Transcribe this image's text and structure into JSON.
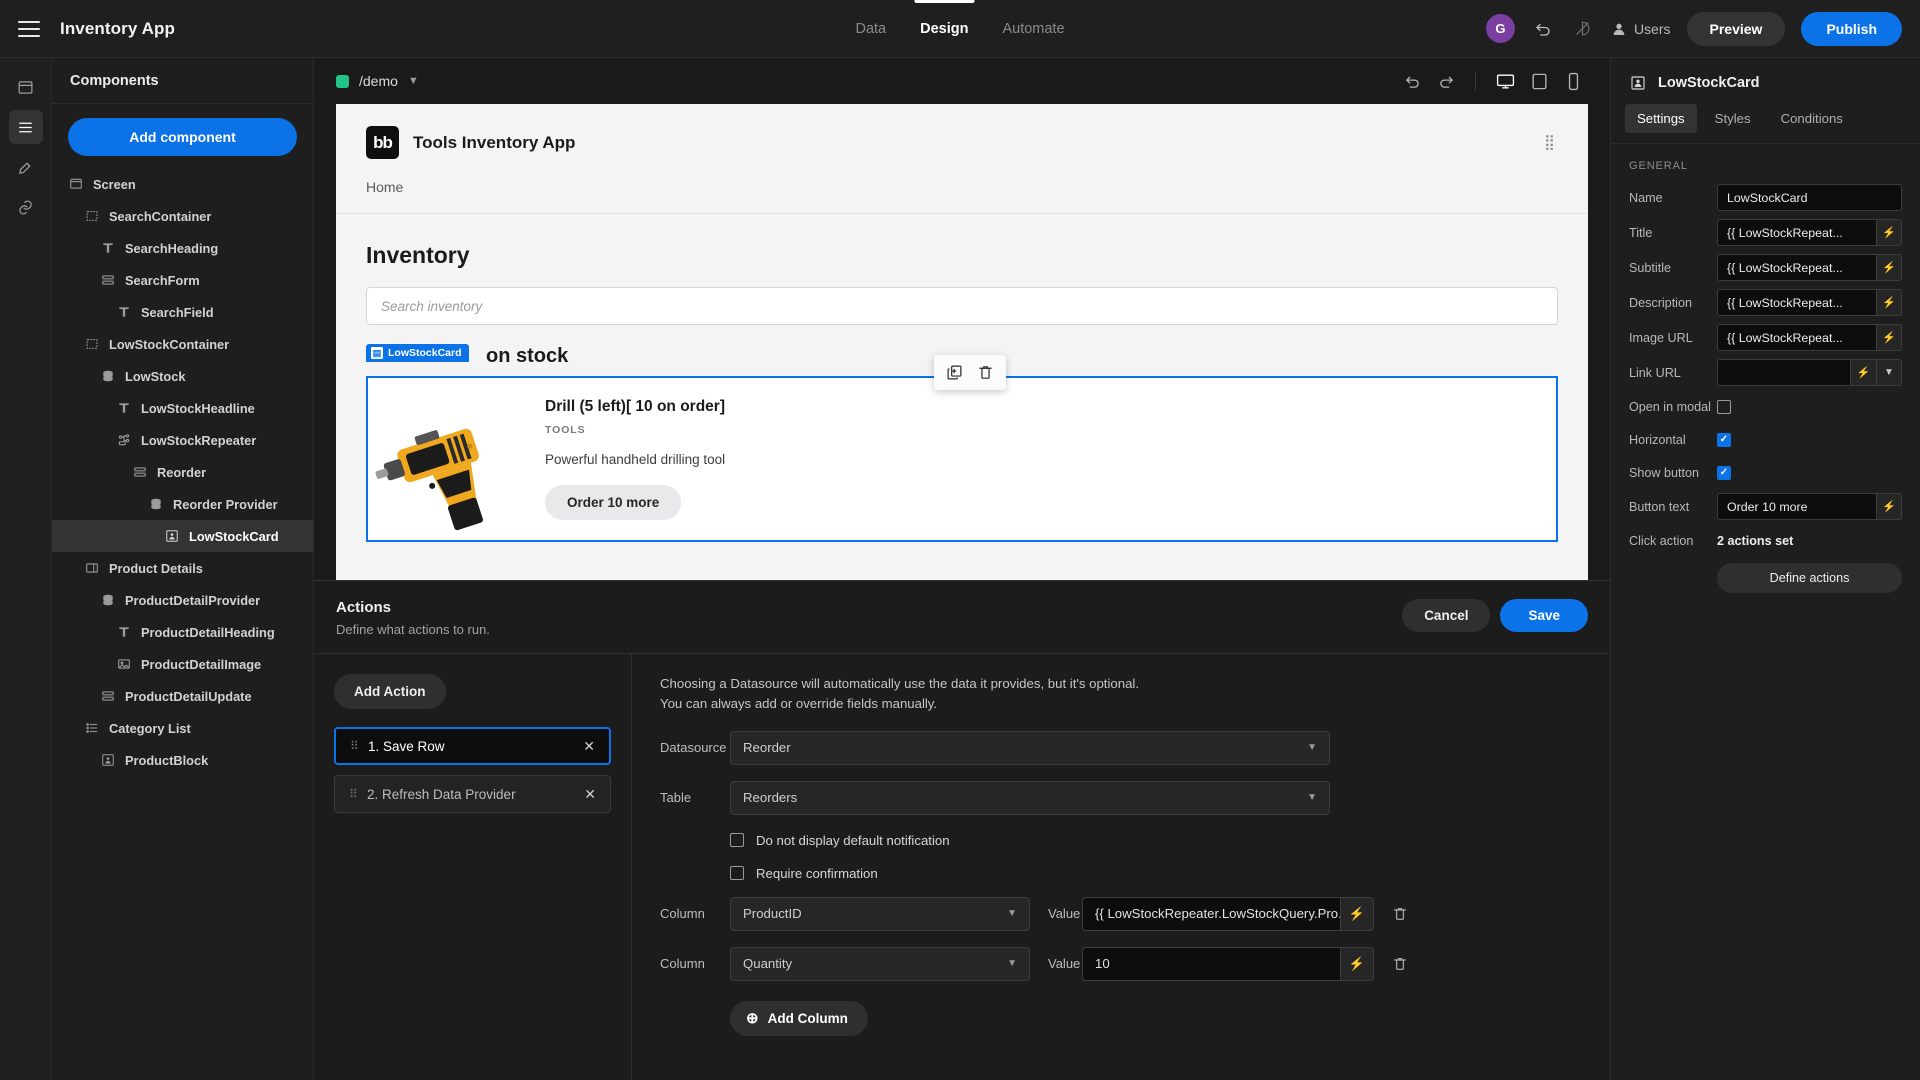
{
  "topbar": {
    "app_title": "Inventory App",
    "menu_icon": "hamburger-icon",
    "tabs": [
      {
        "label": "Data",
        "active": false
      },
      {
        "label": "Design",
        "active": true
      },
      {
        "label": "Automate",
        "active": false
      }
    ],
    "avatar_initial": "G",
    "undo_icon": "undo-icon",
    "theme_icon": "theme-icon",
    "users_label": "Users",
    "preview_label": "Preview",
    "publish_label": "Publish"
  },
  "rail": {
    "items": [
      {
        "name": "screens-icon"
      },
      {
        "name": "components-icon"
      },
      {
        "name": "theme-icon"
      },
      {
        "name": "links-icon"
      }
    ]
  },
  "components": {
    "header": "Components",
    "add_button": "Add component",
    "tree": [
      {
        "label": "Screen",
        "depth": 0,
        "icon": "screen-icon",
        "selected": false
      },
      {
        "label": "SearchContainer",
        "depth": 1,
        "icon": "container-icon",
        "selected": false
      },
      {
        "label": "SearchHeading",
        "depth": 2,
        "icon": "text-icon",
        "selected": false
      },
      {
        "label": "SearchForm",
        "depth": 2,
        "icon": "form-icon",
        "selected": false
      },
      {
        "label": "SearchField",
        "depth": 3,
        "icon": "text-icon",
        "selected": false
      },
      {
        "label": "LowStockContainer",
        "depth": 1,
        "icon": "container-icon",
        "selected": false
      },
      {
        "label": "LowStock",
        "depth": 2,
        "icon": "data-icon",
        "selected": false
      },
      {
        "label": "LowStockHeadline",
        "depth": 3,
        "icon": "text-icon",
        "selected": false
      },
      {
        "label": "LowStockRepeater",
        "depth": 3,
        "icon": "repeater-icon",
        "selected": false
      },
      {
        "label": "Reorder",
        "depth": 4,
        "icon": "form-icon",
        "selected": false
      },
      {
        "label": "Reorder Provider",
        "depth": 5,
        "icon": "data-icon",
        "selected": false
      },
      {
        "label": "LowStockCard",
        "depth": 6,
        "icon": "card-icon",
        "selected": true
      },
      {
        "label": "Product Details",
        "depth": 1,
        "icon": "sidepanel-icon",
        "selected": false
      },
      {
        "label": "ProductDetailProvider",
        "depth": 2,
        "icon": "data-icon",
        "selected": false
      },
      {
        "label": "ProductDetailHeading",
        "depth": 3,
        "icon": "text-icon",
        "selected": false
      },
      {
        "label": "ProductDetailImage",
        "depth": 3,
        "icon": "image-icon",
        "selected": false
      },
      {
        "label": "ProductDetailUpdate",
        "depth": 2,
        "icon": "form-icon",
        "selected": false
      },
      {
        "label": "Category List",
        "depth": 1,
        "icon": "list-icon",
        "selected": false
      },
      {
        "label": "ProductBlock",
        "depth": 2,
        "icon": "card-icon",
        "selected": false
      }
    ]
  },
  "canvas": {
    "route": "/demo",
    "route_dot_color": "#21c489",
    "undo_icon": "undo-icon",
    "redo_icon": "redo-icon",
    "device_desktop": "desktop-icon",
    "device_tablet": "tablet-icon",
    "device_mobile": "mobile-icon"
  },
  "preview": {
    "logo_text": "bb",
    "app_name": "Tools Inventory App",
    "nav_home": "Home",
    "heading": "Inventory",
    "search_placeholder": "Search inventory",
    "low_stock_heading": "on stock",
    "selected_badge": "LowStockCard",
    "card": {
      "title": "Drill (5 left)[ 10 on order]",
      "subtitle": "TOOLS",
      "description": "Powerful handheld drilling tool",
      "button": "Order 10 more"
    },
    "float_tools": [
      "duplicate-icon",
      "delete-icon"
    ]
  },
  "drawer": {
    "title": "Actions",
    "subtitle": "Define what actions to run.",
    "cancel_label": "Cancel",
    "save_label": "Save",
    "add_action_label": "Add Action",
    "actions": [
      {
        "label": "1. Save Row",
        "active": true
      },
      {
        "label": "2. Refresh Data Provider",
        "active": false
      }
    ],
    "hint_line_1": "Choosing a Datasource will automatically use the data it provides, but it's optional.",
    "hint_line_2": "You can always add or override fields manually.",
    "datasource_label": "Datasource",
    "datasource_value": "Reorder",
    "table_label": "Table",
    "table_value": "Reorders",
    "checkboxes": [
      {
        "label": "Do not display default notification",
        "checked": false
      },
      {
        "label": "Require confirmation",
        "checked": false
      }
    ],
    "column_label": "Column",
    "value_label": "Value",
    "columns": [
      {
        "column": "ProductID",
        "value": "{{ LowStockRepeater.LowStockQuery.Pro..."
      },
      {
        "column": "Quantity",
        "value": "10"
      }
    ],
    "add_column_label": "Add Column"
  },
  "settings": {
    "component_name": "LowStockCard",
    "component_icon": "card-icon",
    "tabs": [
      {
        "label": "Settings",
        "active": true
      },
      {
        "label": "Styles",
        "active": false
      },
      {
        "label": "Conditions",
        "active": false
      }
    ],
    "section_general": "GENERAL",
    "fields": [
      {
        "label": "Name",
        "type": "text",
        "value": "LowStockCard",
        "bolt": false
      },
      {
        "label": "Title",
        "type": "text",
        "value": "{{ LowStockRepeat...",
        "bolt": true
      },
      {
        "label": "Subtitle",
        "type": "text",
        "value": "{{ LowStockRepeat...",
        "bolt": true
      },
      {
        "label": "Description",
        "type": "text",
        "value": "{{ LowStockRepeat...",
        "bolt": true
      },
      {
        "label": "Image URL",
        "type": "text",
        "value": "{{ LowStockRepeat...",
        "bolt": true
      },
      {
        "label": "Link URL",
        "type": "text-dropdown",
        "value": "",
        "bolt": true
      },
      {
        "label": "Open in modal",
        "type": "checkbox",
        "checked": false
      },
      {
        "label": "Horizontal",
        "type": "checkbox",
        "checked": true
      },
      {
        "label": "Show button",
        "type": "checkbox",
        "checked": true
      },
      {
        "label": "Button text",
        "type": "text",
        "value": "Order 10 more",
        "bolt": true
      },
      {
        "label": "Click action",
        "type": "value",
        "value": "2 actions set"
      }
    ],
    "define_actions_label": "Define actions",
    "accent_color": "#0b72e7"
  }
}
